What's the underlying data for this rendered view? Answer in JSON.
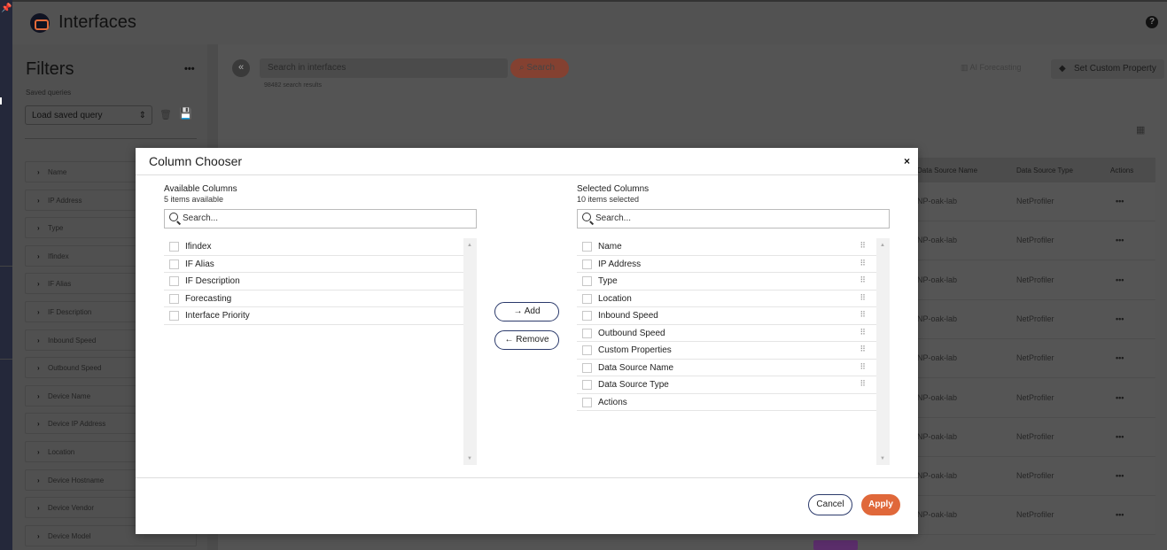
{
  "header": {
    "title": "Interfaces",
    "help": "?"
  },
  "filters": {
    "title": "Filters",
    "more": "•••",
    "saved_queries_label": "Saved queries",
    "load_query_label": "Load saved query",
    "items": [
      "Name",
      "IP Address",
      "Type",
      "Ifindex",
      "IF Alias",
      "IF Description",
      "Inbound Speed",
      "Outbound Speed",
      "Device Name",
      "Device IP Address",
      "Location",
      "Device Hostname",
      "Device Vendor",
      "Device Model"
    ]
  },
  "main": {
    "search_placeholder": "Search in interfaces",
    "search_button": "Search",
    "results": "98482 search results",
    "ai_forecasting": "AI Forecasting",
    "set_custom_property": "Set Custom Property",
    "columns": {
      "ds_name": "Data Source Name",
      "ds_type": "Data Source Type",
      "actions": "Actions"
    },
    "row_ds_name": "NP-oak-lab",
    "row_ds_type": "NetProfiler",
    "row_actions": "•••"
  },
  "modal": {
    "title": "Column Chooser",
    "close": "×",
    "available": {
      "title": "Available Columns",
      "count": "5 items available",
      "search_placeholder": "Search...",
      "items": [
        "Ifindex",
        "IF Alias",
        "IF Description",
        "Forecasting",
        "Interface Priority"
      ]
    },
    "selected": {
      "title": "Selected Columns",
      "count": "10 items selected",
      "search_placeholder": "Search...",
      "items": [
        "Name",
        "IP Address",
        "Type",
        "Location",
        "Inbound Speed",
        "Outbound Speed",
        "Custom Properties",
        "Data Source Name",
        "Data Source Type",
        "Actions"
      ]
    },
    "add_label": "→ Add",
    "remove_label": "← Remove",
    "cancel_label": "Cancel",
    "apply_label": "Apply"
  }
}
